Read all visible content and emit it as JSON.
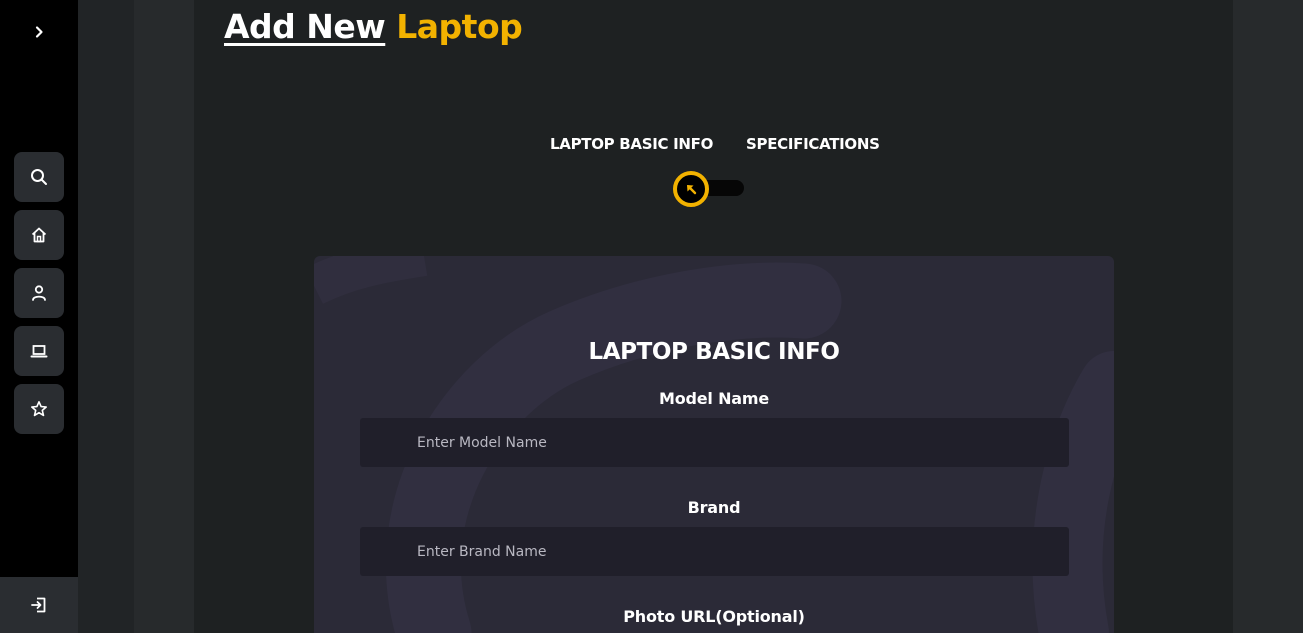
{
  "page": {
    "title_part1": "Add New",
    "title_part2": "Laptop"
  },
  "sidebar": {
    "toggle_icon": "chevron-right-icon",
    "items": [
      {
        "icon": "search-icon"
      },
      {
        "icon": "home-icon"
      },
      {
        "icon": "user-icon"
      },
      {
        "icon": "laptop-icon"
      },
      {
        "icon": "star-icon"
      }
    ],
    "logout_icon": "logout-icon"
  },
  "stepper": {
    "steps": [
      "LAPTOP BASIC INFO",
      "SPECIFICATIONS"
    ],
    "current_step": 1,
    "accent_color": "#f2b200"
  },
  "form": {
    "heading": "LAPTOP BASIC INFO",
    "fields": [
      {
        "label": "Model Name",
        "placeholder": "Enter Model Name",
        "value": ""
      },
      {
        "label": "Brand",
        "placeholder": "Enter Brand Name",
        "value": ""
      },
      {
        "label": "Photo URL(Optional)"
      }
    ]
  },
  "colors": {
    "accent": "#f2b200",
    "sidebar_bg": "#000000",
    "card_bg": "#2b2a37",
    "input_bg": "#201f2a"
  }
}
